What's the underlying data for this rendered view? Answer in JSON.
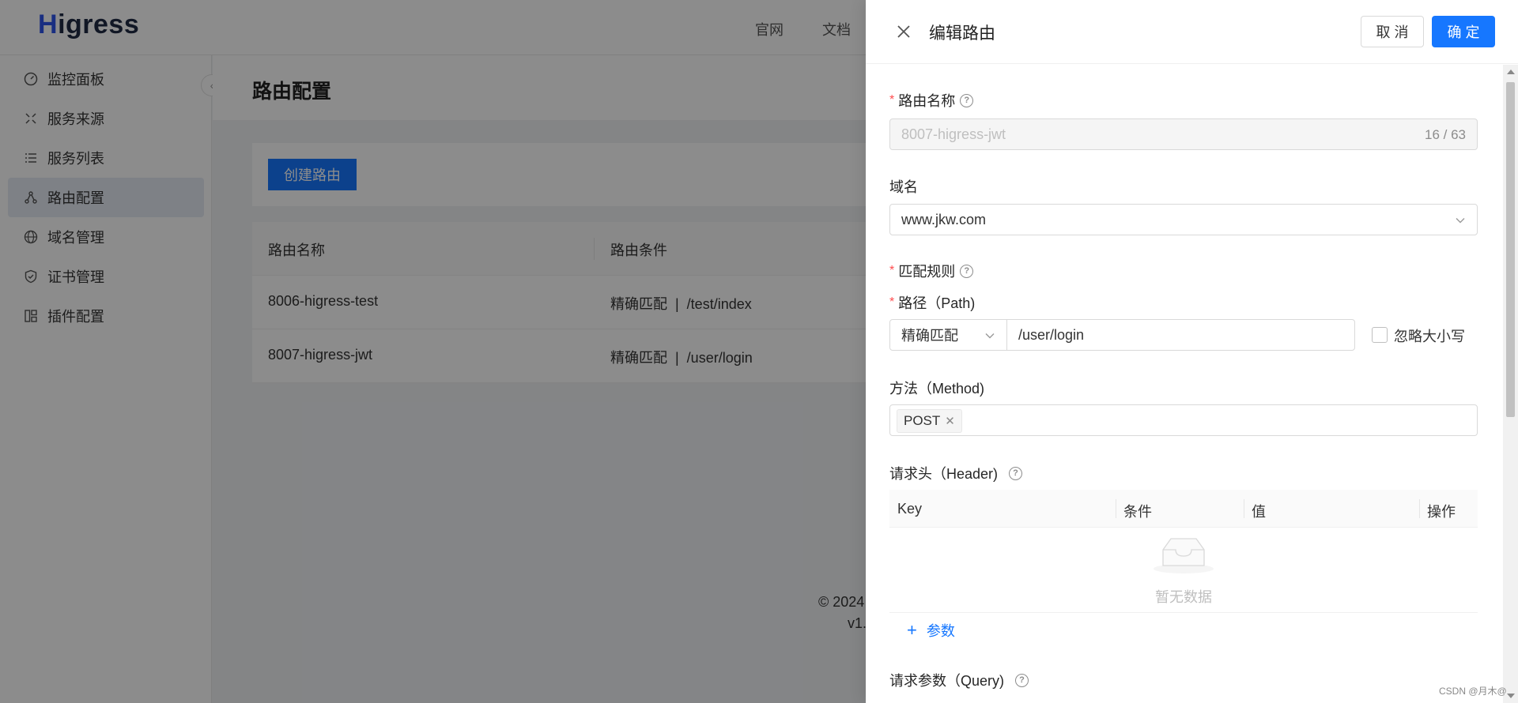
{
  "app": {
    "logo": "Higress",
    "top_nav": [
      "官网",
      "文档"
    ],
    "sidebar": [
      {
        "label": "监控面板",
        "icon": "dashboard-icon"
      },
      {
        "label": "服务来源",
        "icon": "service-source-icon"
      },
      {
        "label": "服务列表",
        "icon": "list-icon"
      },
      {
        "label": "路由配置",
        "icon": "route-icon",
        "active": true
      },
      {
        "label": "域名管理",
        "icon": "globe-icon"
      },
      {
        "label": "证书管理",
        "icon": "shield-icon"
      },
      {
        "label": "插件配置",
        "icon": "plugin-icon"
      }
    ],
    "page_title": "路由配置",
    "create_button": "创建路由",
    "table": {
      "columns": [
        "路由名称",
        "路由条件"
      ],
      "rows": [
        {
          "name": "8006-higress-test",
          "condition": "精确匹配  |  /test/index"
        },
        {
          "name": "8007-higress-jwt",
          "condition": "精确匹配  |  /user/login"
        }
      ]
    },
    "footer": {
      "copyright": "© 2024",
      "version": "v1."
    }
  },
  "drawer": {
    "title": "编辑路由",
    "cancel_label": "取 消",
    "ok_label": "确 定",
    "route_name": {
      "label": "路由名称",
      "value": "8007-higress-jwt",
      "count": "16 / 63"
    },
    "domain": {
      "label": "域名",
      "value": "www.jkw.com"
    },
    "match_rule": {
      "label": "匹配规则"
    },
    "path": {
      "label": "路径（Path)",
      "match_type": "精确匹配",
      "value": "/user/login",
      "ignore_case_label": "忽略大小写"
    },
    "method": {
      "label": "方法（Method)",
      "tags": [
        "POST"
      ]
    },
    "header": {
      "label": "请求头（Header)",
      "columns": [
        "Key",
        "条件",
        "值",
        "操作"
      ],
      "empty_text": "暂无数据",
      "add_label": "参数"
    },
    "query": {
      "label": "请求参数（Query)"
    }
  },
  "watermark": "CSDN @月木@",
  "colors": {
    "primary": "#1677ff",
    "required": "#ff4d4f",
    "overlay": "rgba(0,0,0,0.45)"
  }
}
